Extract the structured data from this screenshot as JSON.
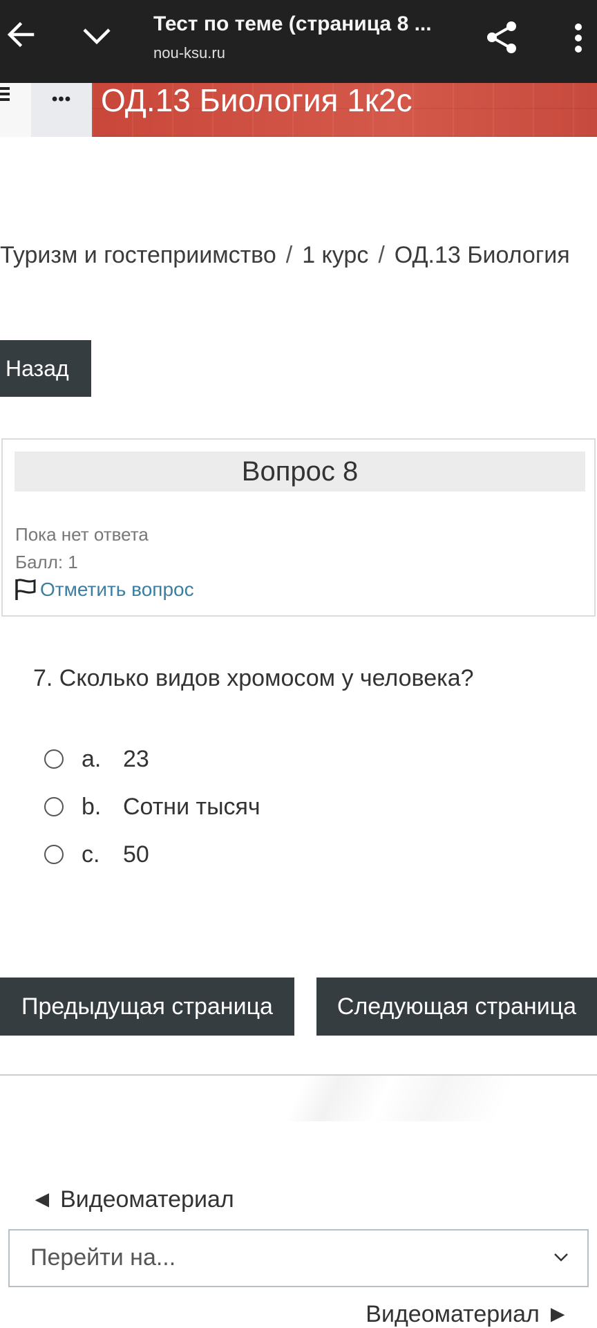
{
  "browser": {
    "title": "Тест по теме (страница 8 ...",
    "url": "nou-ksu.ru"
  },
  "banner": {
    "menu_dots": "•••",
    "course_title": "ОД.13 Биология 1к2с",
    "color": "#c9473a"
  },
  "breadcrumb": {
    "items": [
      "Туризм и гостеприимство",
      "1 курс",
      "ОД.13 Биология"
    ],
    "separator": "/"
  },
  "back_button": "Назад",
  "question_info": {
    "heading": "Вопрос 8",
    "state": "Пока нет ответа",
    "grade": "Балл: 1",
    "flag_label": "Отметить вопрос"
  },
  "question": {
    "text": "7. Сколько видов хромосом у человека?",
    "answers": [
      {
        "letter": "a.",
        "value": "23"
      },
      {
        "letter": "b.",
        "value": "Сотни тысяч"
      },
      {
        "letter": "c.",
        "value": "50"
      }
    ]
  },
  "navigation": {
    "prev_page": "Предыдущая страница",
    "next_page": "Следующая страница"
  },
  "footer": {
    "prev_activity": "◄ Видеоматериал",
    "jump_placeholder": "Перейти на...",
    "next_activity": "Видеоматериал ►"
  },
  "colors": {
    "dark_button": "#363d41",
    "link": "#3b7ea1",
    "topbar": "#212121"
  }
}
